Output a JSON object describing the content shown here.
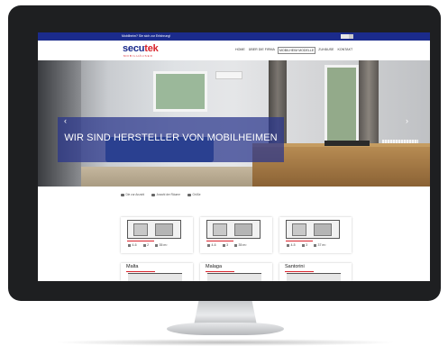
{
  "topbar": {
    "text": "Mobilheim? Sie sich zur Erfahrung!"
  },
  "header": {
    "logo_main": "secu",
    "logo_accent": "tek",
    "logo_sub": "MOBILHÄUSER",
    "nav": [
      "HOME",
      "ÜBER DIE FIRMA",
      "MOBILHEIM MODELLE",
      "ZUHÄUSE",
      "KONTAKT"
    ]
  },
  "hero": {
    "headline": "WIR SIND HERSTELLER VON MOBILHEIMEN",
    "prev": "‹",
    "next": "›"
  },
  "filters": [
    "Die zur Anzahl",
    "Anzahl der Räume",
    "Größe"
  ],
  "cards": [
    {
      "specs": [
        "4-6",
        "2",
        "35 m²"
      ]
    },
    {
      "specs": [
        "4-6",
        "3",
        "35 m²"
      ]
    },
    {
      "specs": [
        "4-5",
        "3",
        "37 m²"
      ]
    }
  ],
  "cards_row2": [
    {
      "title": "Malta"
    },
    {
      "title": "Malaga"
    },
    {
      "title": "Santorini"
    }
  ],
  "colors": {
    "brand_blue": "#1b2b8c",
    "brand_red": "#d9222a",
    "bezel": "#1e1f21"
  }
}
